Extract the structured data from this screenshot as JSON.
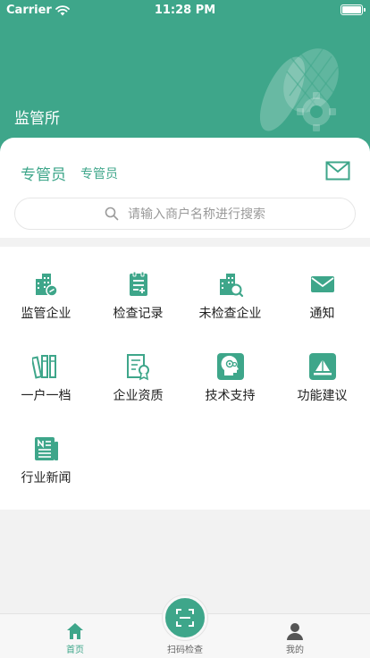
{
  "status": {
    "carrier": "Carrier",
    "time": "11:28 PM"
  },
  "header": {
    "title": "监管所"
  },
  "role": {
    "label": "专管员",
    "value": "专管员"
  },
  "search": {
    "placeholder": "请输入商户名称进行搜索"
  },
  "menu": [
    {
      "label": "监管企业",
      "icon": "building-link-icon"
    },
    {
      "label": "检查记录",
      "icon": "clipboard-add-icon"
    },
    {
      "label": "未检查企业",
      "icon": "building-search-icon"
    },
    {
      "label": "通知",
      "icon": "envelope-icon"
    },
    {
      "label": "一户一档",
      "icon": "binders-icon"
    },
    {
      "label": "企业资质",
      "icon": "certificate-icon"
    },
    {
      "label": "技术支持",
      "icon": "support-head-icon"
    },
    {
      "label": "功能建议",
      "icon": "suggestion-icon"
    },
    {
      "label": "行业新闻",
      "icon": "newspaper-icon"
    }
  ],
  "tabs": [
    {
      "label": "首页",
      "icon": "home-icon",
      "active": true
    },
    {
      "label": "扫码检查",
      "icon": "scan-icon",
      "active": false
    },
    {
      "label": "我的",
      "icon": "user-icon",
      "active": false
    }
  ],
  "colors": {
    "primary": "#3ea68a",
    "text": "#222222",
    "muted": "#9a9a9a",
    "background": "#f2f2f2"
  }
}
